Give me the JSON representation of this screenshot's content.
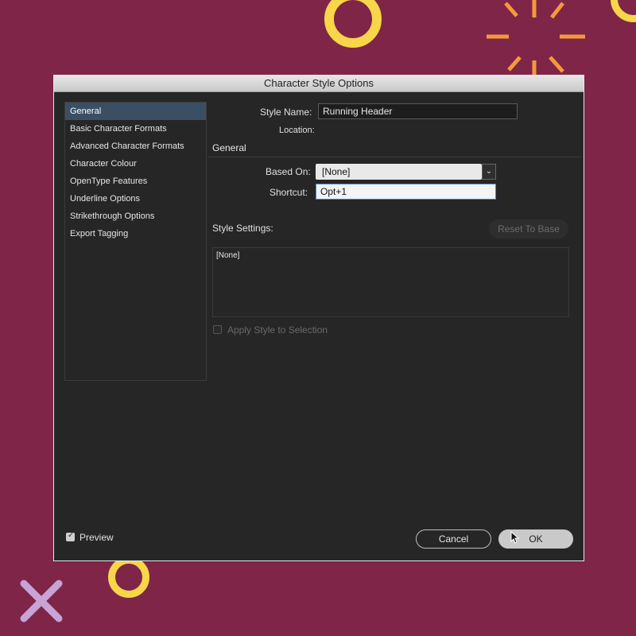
{
  "dialog": {
    "title": "Character Style Options"
  },
  "sidebar": {
    "items": [
      {
        "label": "General"
      },
      {
        "label": "Basic Character Formats"
      },
      {
        "label": "Advanced Character Formats"
      },
      {
        "label": "Character Colour"
      },
      {
        "label": "OpenType Features"
      },
      {
        "label": "Underline Options"
      },
      {
        "label": "Strikethrough Options"
      },
      {
        "label": "Export Tagging"
      }
    ]
  },
  "main": {
    "style_name_label": "Style Name:",
    "style_name_value": "Running Header",
    "location_label": "Location:",
    "general_heading": "General",
    "based_on_label": "Based On:",
    "based_on_value": "[None]",
    "shortcut_label": "Shortcut:",
    "shortcut_value": "Opt+1",
    "style_settings_label": "Style Settings:",
    "reset_button": "Reset To Base",
    "style_settings_text": "[None]",
    "apply_style_label": "Apply Style to Selection"
  },
  "footer": {
    "preview_label": "Preview",
    "cancel_button": "Cancel",
    "ok_button": "OK"
  },
  "colors": {
    "background": "#7f2548",
    "accent_yellow": "#f7d649",
    "accent_orange": "#f39a3c",
    "accent_lavender": "#c7a3d6",
    "dialog_bg": "#262626",
    "selection": "#3b4f64"
  }
}
